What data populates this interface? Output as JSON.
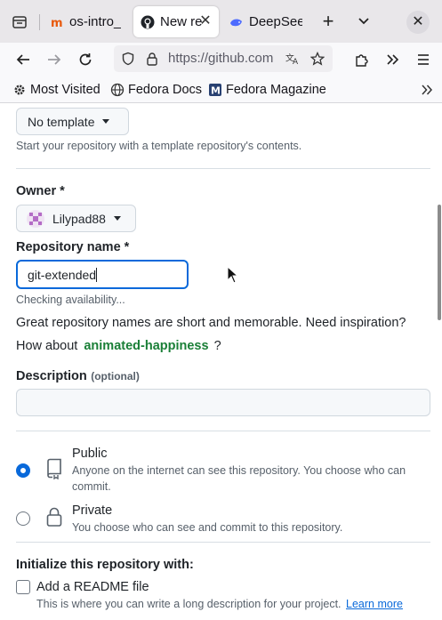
{
  "browser": {
    "tabs": [
      {
        "title": "os-intro_",
        "active": false
      },
      {
        "title": "New re",
        "active": true
      },
      {
        "title": "DeepSeek",
        "active": false
      }
    ],
    "new_tab_symbol": "+",
    "url": "https://github.com",
    "bookmarks": [
      {
        "label": "Most Visited",
        "icon": "gear-icon"
      },
      {
        "label": "Fedora Docs",
        "icon": "globe-icon"
      },
      {
        "label": "Fedora Magazine",
        "icon": "fedora-magazine-icon"
      }
    ]
  },
  "form": {
    "template": {
      "selected": "No template",
      "help": "Start your repository with a template repository's contents."
    },
    "owner": {
      "label": "Owner *",
      "value": "Lilypad88"
    },
    "repo_name": {
      "label": "Repository name *",
      "value": "git-extended",
      "status": "Checking availability..."
    },
    "inspiration": {
      "line1": "Great repository names are short and memorable. Need inspiration?",
      "prefix": "How about",
      "suggestion": "animated-happiness",
      "suffix": "?"
    },
    "description": {
      "label": "Description",
      "optional": "(optional)",
      "value": ""
    },
    "visibility": {
      "public": {
        "title": "Public",
        "desc_line1": "Anyone on the internet can see this repository. You choose who can",
        "desc_line2": "commit.",
        "checked": true
      },
      "private": {
        "title": "Private",
        "desc": "You choose who can see and commit to this repository.",
        "checked": false
      }
    },
    "initialize": {
      "heading": "Initialize this repository with:",
      "readme_label": "Add a README file",
      "readme_checked": false,
      "readme_desc": "This is where you can write a long description for your project.",
      "learn_more": "Learn more"
    }
  },
  "colors": {
    "accent": "#0969da",
    "suggestion": "#1a7f37",
    "muted": "#57606a"
  }
}
